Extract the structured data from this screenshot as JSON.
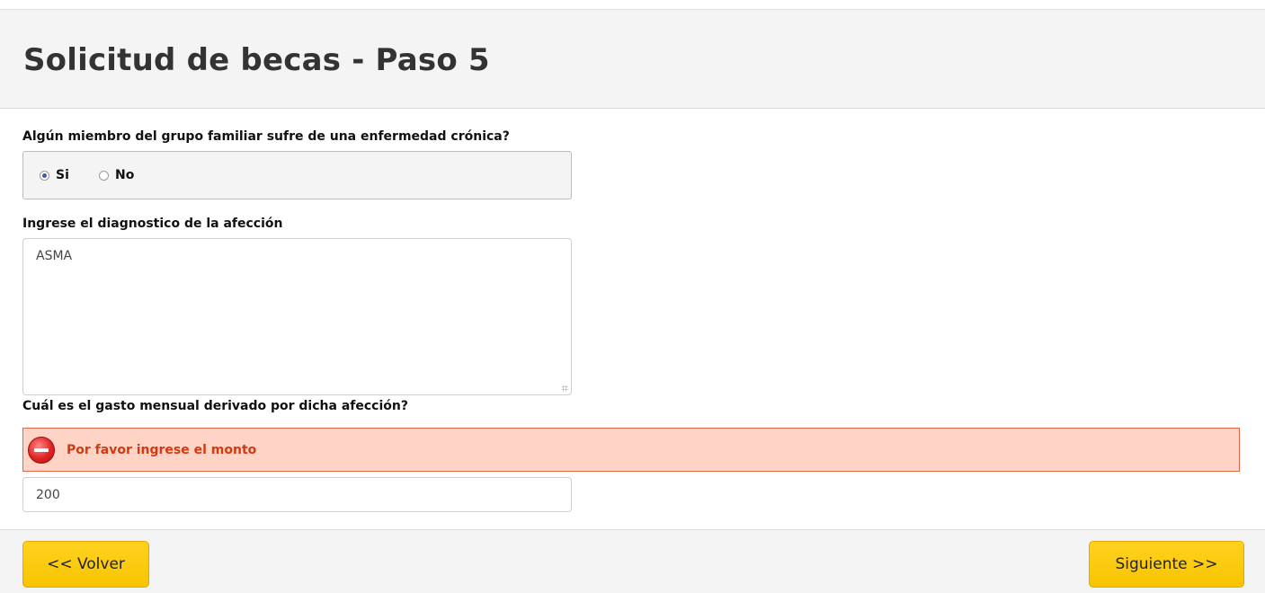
{
  "page": {
    "title": "Solicitud de becas - Paso 5"
  },
  "form": {
    "chronic_question": "Algún miembro del grupo familiar sufre de una enfermedad crónica?",
    "options": [
      {
        "label": "Si",
        "selected": true
      },
      {
        "label": "No",
        "selected": false
      }
    ],
    "diagnosis_label": "Ingrese el diagnostico de la afección",
    "diagnosis_value": "ASMA",
    "expense_label": "Cuál es el gasto mensual derivado por dicha afección?",
    "error_message": "Por favor ingrese el monto",
    "expense_value": "200"
  },
  "footer": {
    "back_label": "<< Volver",
    "next_label": "Siguiente >>"
  },
  "colors": {
    "button": "#f7c400",
    "error_bg": "#ffd3c6",
    "error_text": "#d13b12"
  }
}
